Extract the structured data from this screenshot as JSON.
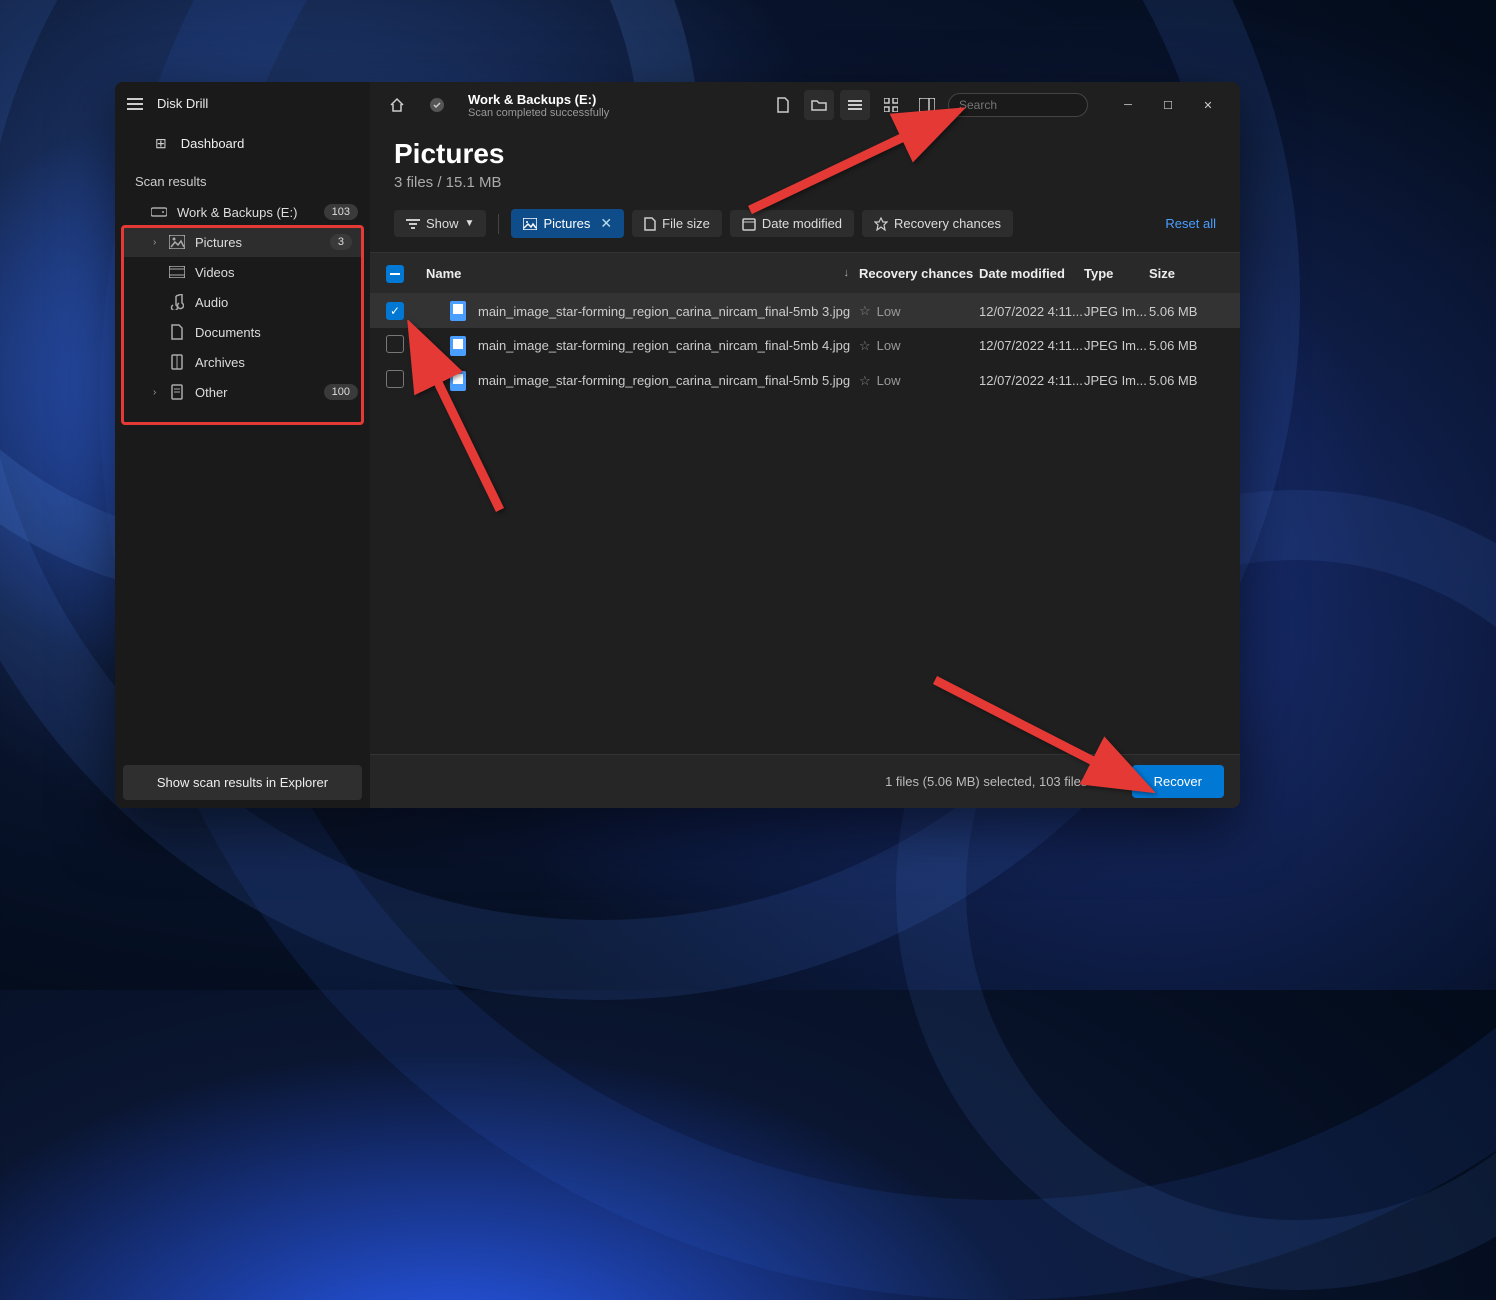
{
  "app": {
    "title": "Disk Drill"
  },
  "sidebar": {
    "dashboard_label": "Dashboard",
    "section_label": "Scan results",
    "items": [
      {
        "label": "Work & Backups (E:)",
        "badge": "103"
      },
      {
        "label": "Pictures",
        "badge": "3"
      },
      {
        "label": "Videos"
      },
      {
        "label": "Audio"
      },
      {
        "label": "Documents"
      },
      {
        "label": "Archives"
      },
      {
        "label": "Other",
        "badge": "100"
      }
    ],
    "footer_btn": "Show scan results in Explorer"
  },
  "header": {
    "drive_title": "Work & Backups (E:)",
    "drive_sub": "Scan completed successfully",
    "search_placeholder": "Search"
  },
  "page": {
    "title": "Pictures",
    "subtitle": "3 files / 15.1 MB"
  },
  "filters": {
    "show": "Show",
    "pictures": "Pictures",
    "file_size": "File size",
    "date_modified": "Date modified",
    "recovery_chances": "Recovery chances",
    "reset": "Reset all"
  },
  "columns": {
    "name": "Name",
    "recovery": "Recovery chances",
    "date": "Date modified",
    "type": "Type",
    "size": "Size"
  },
  "files": [
    {
      "name": "main_image_star-forming_region_carina_nircam_final-5mb 3.jpg",
      "recovery": "Low",
      "date": "12/07/2022 4:11...",
      "type": "JPEG Im...",
      "size": "5.06 MB",
      "checked": true
    },
    {
      "name": "main_image_star-forming_region_carina_nircam_final-5mb 4.jpg",
      "recovery": "Low",
      "date": "12/07/2022 4:11...",
      "type": "JPEG Im...",
      "size": "5.06 MB",
      "checked": false
    },
    {
      "name": "main_image_star-forming_region_carina_nircam_final-5mb 5.jpg",
      "recovery": "Low",
      "date": "12/07/2022 4:11...",
      "type": "JPEG Im...",
      "size": "5.06 MB",
      "checked": false
    }
  ],
  "status": {
    "text": "1 files (5.06 MB) selected, 103 files total",
    "recover": "Recover"
  }
}
